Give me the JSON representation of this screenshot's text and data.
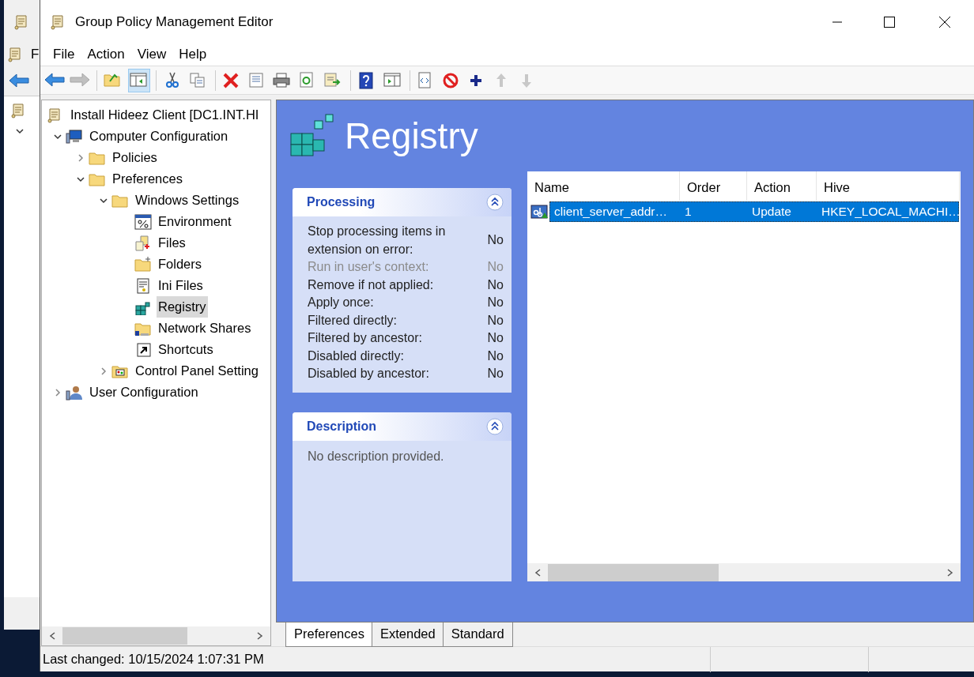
{
  "background_window": {
    "menu_fragment": "F"
  },
  "window": {
    "title": "Group Policy Management Editor"
  },
  "menu": [
    {
      "label": "File"
    },
    {
      "label": "Action"
    },
    {
      "label": "View"
    },
    {
      "label": "Help"
    }
  ],
  "toolbar": [
    {
      "kind": "back",
      "disabled": false,
      "pressed": false
    },
    {
      "kind": "forward",
      "disabled": true,
      "pressed": false
    },
    {
      "kind": "separator"
    },
    {
      "kind": "up-folder",
      "disabled": false,
      "pressed": false
    },
    {
      "kind": "console-tree",
      "disabled": false,
      "pressed": true
    },
    {
      "kind": "separator"
    },
    {
      "kind": "cut",
      "disabled": false,
      "pressed": false
    },
    {
      "kind": "copy",
      "disabled": false,
      "pressed": false
    },
    {
      "kind": "separator"
    },
    {
      "kind": "delete",
      "disabled": false,
      "pressed": false
    },
    {
      "kind": "properties",
      "disabled": false,
      "pressed": false
    },
    {
      "kind": "print",
      "disabled": false,
      "pressed": false
    },
    {
      "kind": "refresh",
      "disabled": false,
      "pressed": false
    },
    {
      "kind": "export",
      "disabled": false,
      "pressed": false
    },
    {
      "kind": "separator"
    },
    {
      "kind": "help",
      "disabled": false,
      "pressed": false
    },
    {
      "kind": "action-pane",
      "disabled": false,
      "pressed": false
    },
    {
      "kind": "separator"
    },
    {
      "kind": "xml",
      "disabled": false,
      "pressed": false
    },
    {
      "kind": "disable",
      "disabled": false,
      "pressed": false
    },
    {
      "kind": "add",
      "disabled": false,
      "pressed": false
    },
    {
      "kind": "move-up",
      "disabled": true,
      "pressed": false
    },
    {
      "kind": "move-down",
      "disabled": true,
      "pressed": false
    }
  ],
  "tree": {
    "root": {
      "label": "Install Hideez Client [DC1.INT.HI",
      "kind": "scroll",
      "selected": false
    },
    "items": [
      {
        "label": "Computer Configuration",
        "kind": "computer",
        "expanded": true,
        "selected": false,
        "children": [
          {
            "label": "Policies",
            "kind": "folder",
            "expanded": false,
            "selected": false
          },
          {
            "label": "Preferences",
            "kind": "folder",
            "expanded": true,
            "selected": false,
            "children": [
              {
                "label": "Windows Settings",
                "kind": "folder",
                "expanded": true,
                "selected": false,
                "children": [
                  {
                    "label": "Environment",
                    "kind": "environment",
                    "selected": false
                  },
                  {
                    "label": "Files",
                    "kind": "files",
                    "selected": false
                  },
                  {
                    "label": "Folders",
                    "kind": "folders",
                    "selected": false
                  },
                  {
                    "label": "Ini Files",
                    "kind": "ini",
                    "selected": false
                  },
                  {
                    "label": "Registry",
                    "kind": "registry",
                    "selected": true
                  },
                  {
                    "label": "Network Shares",
                    "kind": "shares",
                    "selected": false
                  },
                  {
                    "label": "Shortcuts",
                    "kind": "shortcut",
                    "selected": false
                  }
                ]
              },
              {
                "label": "Control Panel Setting",
                "kind": "control-panel",
                "expanded": false,
                "selected": false
              }
            ]
          }
        ]
      },
      {
        "label": "User Configuration",
        "kind": "user",
        "expanded": false,
        "selected": false
      }
    ]
  },
  "details": {
    "title": "Registry",
    "processing": {
      "title": "Processing",
      "rows": [
        {
          "label": "Stop processing items in extension on error:",
          "value": "No",
          "disabled": false
        },
        {
          "label": "Run in user's context:",
          "value": "No",
          "disabled": true
        },
        {
          "label": "Remove if not applied:",
          "value": "No",
          "disabled": false
        },
        {
          "label": "Apply once:",
          "value": "No",
          "disabled": false
        },
        {
          "label": "Filtered directly:",
          "value": "No",
          "disabled": false
        },
        {
          "label": "Filtered by ancestor:",
          "value": "No",
          "disabled": false
        },
        {
          "label": "Disabled directly:",
          "value": "No",
          "disabled": false
        },
        {
          "label": "Disabled by ancestor:",
          "value": "No",
          "disabled": false
        }
      ]
    },
    "description": {
      "title": "Description",
      "text": "No description provided."
    }
  },
  "list": {
    "columns": [
      "Name",
      "Order",
      "Action",
      "Hive"
    ],
    "rows": [
      {
        "cells": [
          "client_server_addr…",
          "1",
          "Update",
          "HKEY_LOCAL_MACHI…"
        ],
        "selected": true
      }
    ]
  },
  "tabs": [
    {
      "label": "Preferences",
      "selected": true
    },
    {
      "label": "Extended",
      "selected": false
    },
    {
      "label": "Standard",
      "selected": false
    }
  ],
  "status_bar": {
    "text": "Last changed: 10/15/2024 1:07:31 PM"
  }
}
